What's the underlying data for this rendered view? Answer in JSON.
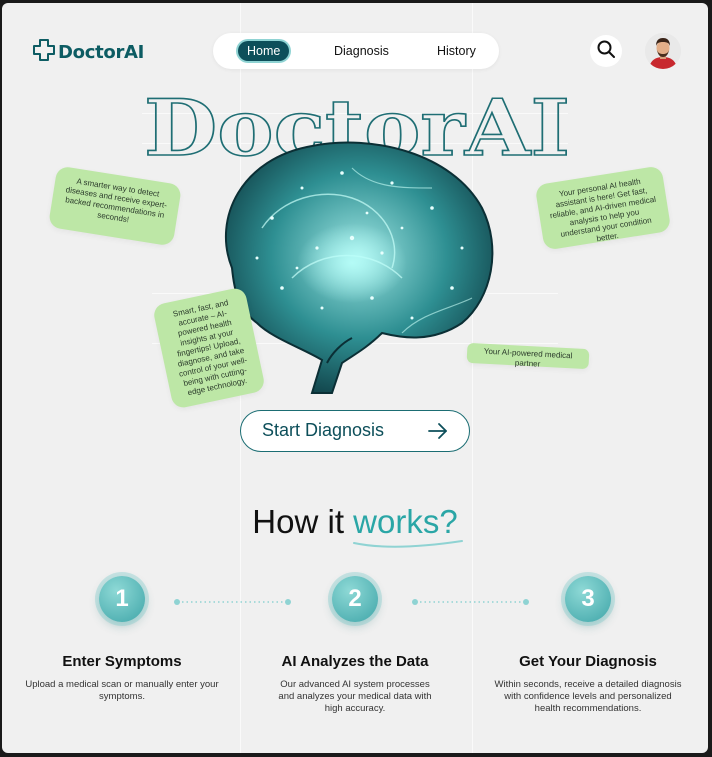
{
  "brand": {
    "name": "DoctorAI",
    "accent": "#0d5c63",
    "note_color": "#bde7a6",
    "teal": "#2aa6a6"
  },
  "nav": {
    "home": "Home",
    "diagnosis": "Diagnosis",
    "history": "History"
  },
  "hero": {
    "title": "DoctorAI",
    "note_left": "A smarter way to detect diseases and receive expert-backed recommendations in seconds!",
    "note_right": "Your personal AI health assistant is here! Get fast, reliable, and AI-driven medical analysis to help you understand your condition better.",
    "note_middle": "Smart, fast, and accurate – AI-powered health insights at your fingertips! Upload, diagnose, and take control of your well-being with cutting-edge technology.",
    "note_partner": "Your AI-powered medical partner",
    "cta": "Start Diagnosis"
  },
  "how": {
    "title_main": "How it ",
    "title_accent": "works?",
    "steps": [
      {
        "number": "1",
        "title": "Enter Symptoms",
        "desc": "Upload a medical scan or manually enter your symptoms."
      },
      {
        "number": "2",
        "title": "AI Analyzes the Data",
        "desc": "Our advanced AI system processes and analyzes your medical data with high accuracy."
      },
      {
        "number": "3",
        "title": "Get Your Diagnosis",
        "desc": "Within seconds, receive a detailed diagnosis with confidence levels and personalized health recommendations."
      }
    ]
  },
  "icons": {
    "logo": "medical-cross-icon",
    "search": "search-icon",
    "arrow": "arrow-right-icon"
  }
}
